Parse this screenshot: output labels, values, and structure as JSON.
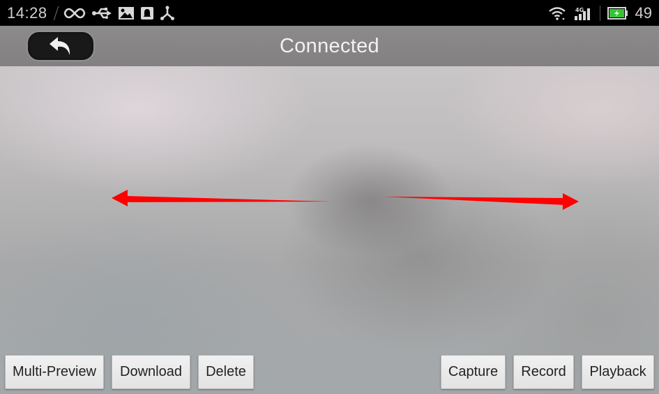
{
  "status_bar": {
    "time": "14:28",
    "left_icons": [
      "infinity-icon",
      "usb-icon",
      "image-icon",
      "notification-icon",
      "share-icon"
    ],
    "right_icons": [
      "wifi-icon",
      "4g-signal-icon",
      "battery-charging-icon"
    ],
    "network_label": "4G",
    "battery_percent": "49",
    "battery_color": "#35c435"
  },
  "header": {
    "title": "Connected",
    "back_icon": "back-arrow-icon"
  },
  "annotations": {
    "arrow_color": "#ff0000",
    "arrows": [
      "left-arrow",
      "right-arrow"
    ]
  },
  "toolbar": {
    "left_buttons": [
      {
        "label": "Multi-Preview"
      },
      {
        "label": "Download"
      },
      {
        "label": "Delete"
      }
    ],
    "right_buttons": [
      {
        "label": "Capture"
      },
      {
        "label": "Record"
      },
      {
        "label": "Playback"
      }
    ]
  }
}
